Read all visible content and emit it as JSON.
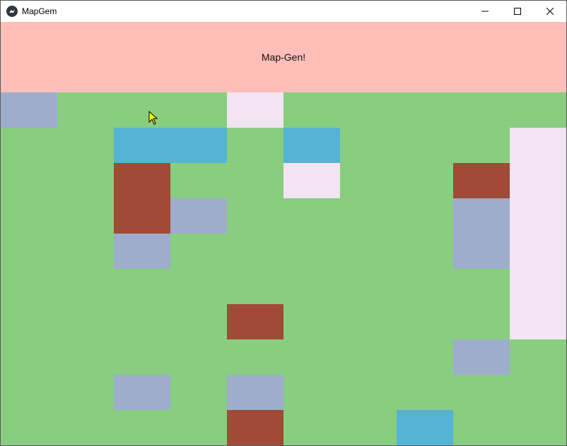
{
  "window": {
    "title": "MapGem",
    "icon": "kivy-icon",
    "controls": {
      "minimize_icon": "minimize-icon",
      "maximize_icon": "maximize-icon",
      "close_icon": "close-icon"
    }
  },
  "banner": {
    "text": "Map-Gen!",
    "color": "#ffbeb7"
  },
  "map": {
    "columns": 10,
    "rows": 10,
    "tile_types": {
      "grass": "#88cd80",
      "stone": "#9eadcc",
      "water": "#55b3d4",
      "dirt": "#a14a35",
      "snow": "#f2e4f2"
    },
    "grid": [
      [
        "stone",
        "grass",
        "grass",
        "grass",
        "snow",
        "grass",
        "grass",
        "grass",
        "grass",
        "grass"
      ],
      [
        "grass",
        "grass",
        "water",
        "water",
        "grass",
        "water",
        "grass",
        "grass",
        "grass",
        "snow"
      ],
      [
        "grass",
        "grass",
        "dirt",
        "grass",
        "grass",
        "snow",
        "grass",
        "grass",
        "dirt",
        "snow"
      ],
      [
        "grass",
        "grass",
        "dirt",
        "stone",
        "grass",
        "grass",
        "grass",
        "grass",
        "stone",
        "snow"
      ],
      [
        "grass",
        "grass",
        "stone",
        "grass",
        "grass",
        "grass",
        "grass",
        "grass",
        "stone",
        "snow"
      ],
      [
        "grass",
        "grass",
        "grass",
        "grass",
        "grass",
        "grass",
        "grass",
        "grass",
        "grass",
        "snow"
      ],
      [
        "grass",
        "grass",
        "grass",
        "grass",
        "dirt",
        "grass",
        "grass",
        "grass",
        "grass",
        "snow"
      ],
      [
        "grass",
        "grass",
        "grass",
        "grass",
        "grass",
        "grass",
        "grass",
        "grass",
        "stone",
        "grass"
      ],
      [
        "grass",
        "grass",
        "stone",
        "grass",
        "stone",
        "grass",
        "grass",
        "grass",
        "grass",
        "grass"
      ],
      [
        "grass",
        "grass",
        "grass",
        "grass",
        "dirt",
        "grass",
        "grass",
        "water",
        "grass",
        "grass"
      ]
    ]
  },
  "cursor": {
    "icon": "mouse-pointer-icon",
    "color": "#ffff00"
  }
}
